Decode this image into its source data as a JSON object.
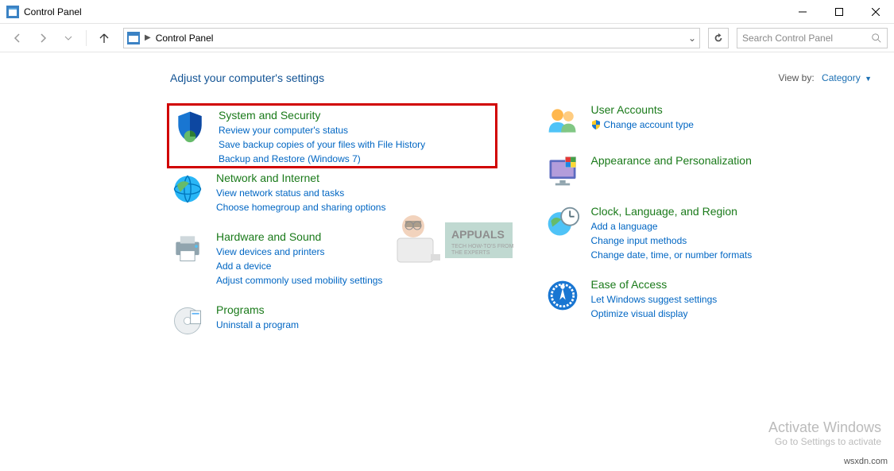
{
  "window": {
    "title": "Control Panel"
  },
  "breadcrumb": {
    "root": "Control Panel"
  },
  "search": {
    "placeholder": "Search Control Panel"
  },
  "header": {
    "title": "Adjust your computer's settings",
    "viewby_label": "View by:",
    "viewby_value": "Category"
  },
  "left": [
    {
      "title": "System and Security",
      "links": [
        "Review your computer's status",
        "Save backup copies of your files with File History",
        "Backup and Restore (Windows 7)"
      ],
      "highlighted": true
    },
    {
      "title": "Network and Internet",
      "links": [
        "View network status and tasks",
        "Choose homegroup and sharing options"
      ]
    },
    {
      "title": "Hardware and Sound",
      "links": [
        "View devices and printers",
        "Add a device",
        "Adjust commonly used mobility settings"
      ]
    },
    {
      "title": "Programs",
      "links": [
        "Uninstall a program"
      ]
    }
  ],
  "right": [
    {
      "title": "User Accounts",
      "links": [
        "Change account type"
      ],
      "shield": [
        0
      ]
    },
    {
      "title": "Appearance and Personalization",
      "links": []
    },
    {
      "title": "Clock, Language, and Region",
      "links": [
        "Add a language",
        "Change input methods",
        "Change date, time, or number formats"
      ]
    },
    {
      "title": "Ease of Access",
      "links": [
        "Let Windows suggest settings",
        "Optimize visual display"
      ]
    }
  ],
  "activate": {
    "line1": "Activate Windows",
    "line2": "Go to Settings to activate"
  },
  "brand": "wsxdn.com"
}
